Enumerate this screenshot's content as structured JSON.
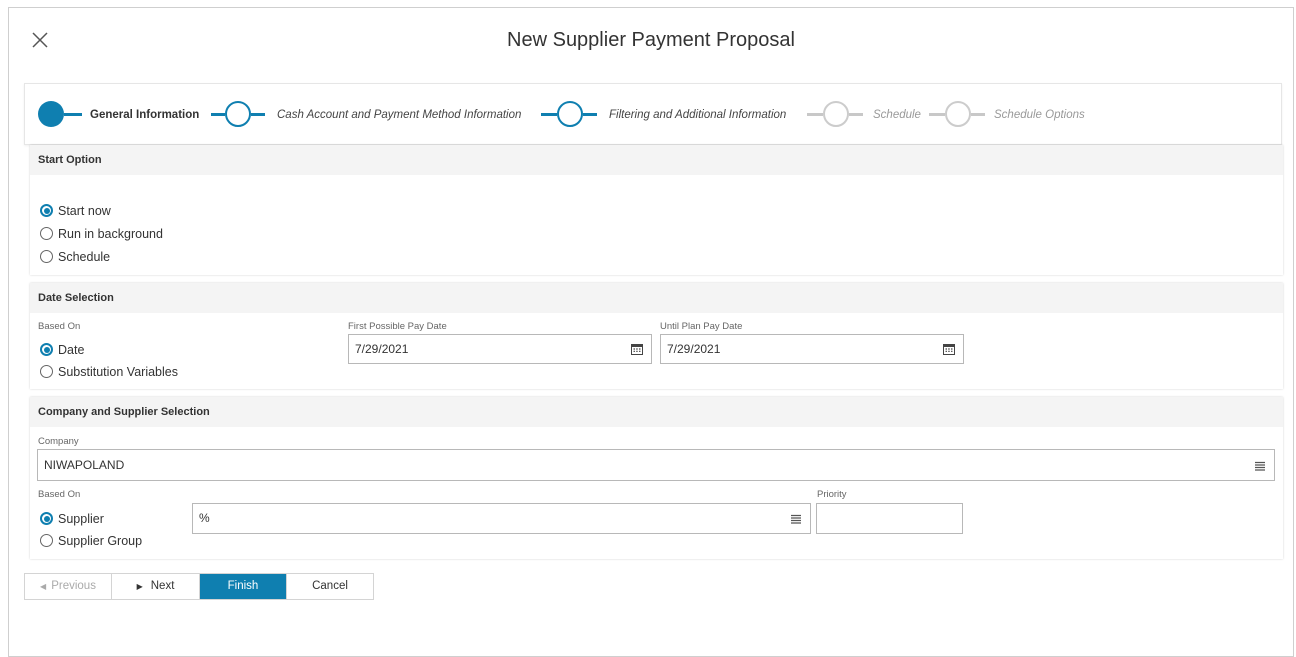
{
  "dialog": {
    "title": "New Supplier Payment Proposal"
  },
  "stepper": {
    "steps": [
      {
        "label": "General Information",
        "state": "active"
      },
      {
        "label": "Cash Account and Payment Method Information",
        "state": "enabled"
      },
      {
        "label": "Filtering and Additional Information",
        "state": "enabled"
      },
      {
        "label": "Schedule",
        "state": "disabled"
      },
      {
        "label": "Schedule Options",
        "state": "disabled"
      }
    ]
  },
  "start_option": {
    "header": "Start Option",
    "options": [
      "Start now",
      "Run in background",
      "Schedule"
    ],
    "selected": "Start now"
  },
  "date_selection": {
    "header": "Date Selection",
    "based_on_label": "Based On",
    "options": [
      "Date",
      "Substitution Variables"
    ],
    "selected": "Date",
    "first_pay_date_label": "First Possible Pay Date",
    "first_pay_date_value": "7/29/2021",
    "until_plan_date_label": "Until Plan Pay Date",
    "until_plan_date_value": "7/29/2021"
  },
  "company_supplier": {
    "header": "Company and Supplier Selection",
    "company_label": "Company",
    "company_value": "NIWAPOLAND",
    "based_on_label": "Based On",
    "options": [
      "Supplier",
      "Supplier Group"
    ],
    "selected": "Supplier",
    "supplier_value": "%",
    "priority_label": "Priority",
    "priority_value": ""
  },
  "footer": {
    "previous_label": "Previous",
    "next_label": "Next",
    "finish_label": "Finish",
    "cancel_label": "Cancel"
  },
  "colors": {
    "accent": "#0f7fb0",
    "disabled": "#c8c8c8"
  }
}
